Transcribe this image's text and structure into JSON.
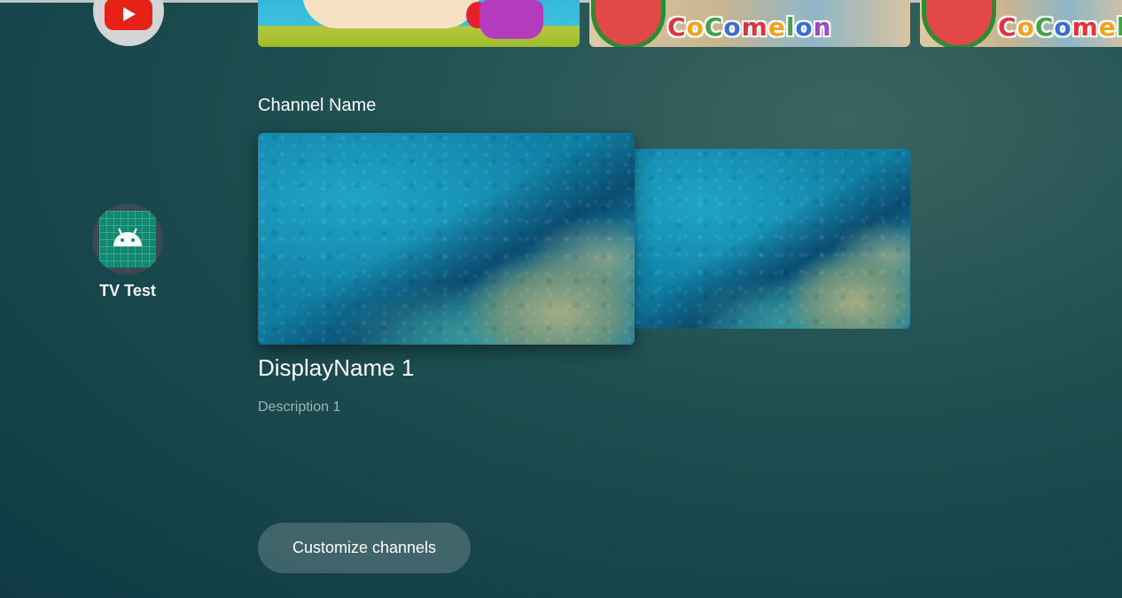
{
  "apps": [
    {
      "name": "YouTube",
      "icon": "youtube-icon",
      "show_label": false
    },
    {
      "name": "TV Test",
      "icon": "android-icon",
      "show_label": true
    }
  ],
  "top_row": {
    "thumbnails": [
      {
        "id": "cartoon-thumbnail"
      },
      {
        "id": "cocomelon-thumbnail",
        "text": "CoComelon"
      },
      {
        "id": "cocomelon-thumbnail",
        "text": "CoComelo"
      }
    ]
  },
  "channel": {
    "title": "Channel Name",
    "programs": [
      {
        "display_name": "DisplayName 1",
        "description": "Description 1"
      },
      {}
    ]
  },
  "customize_button": {
    "label": "Customize channels"
  },
  "colors": {
    "background": "#1e4e50",
    "youtube_red": "#e62117",
    "android_green": "#0f8a72",
    "button_bg": "rgba(255,255,255,0.18)"
  }
}
